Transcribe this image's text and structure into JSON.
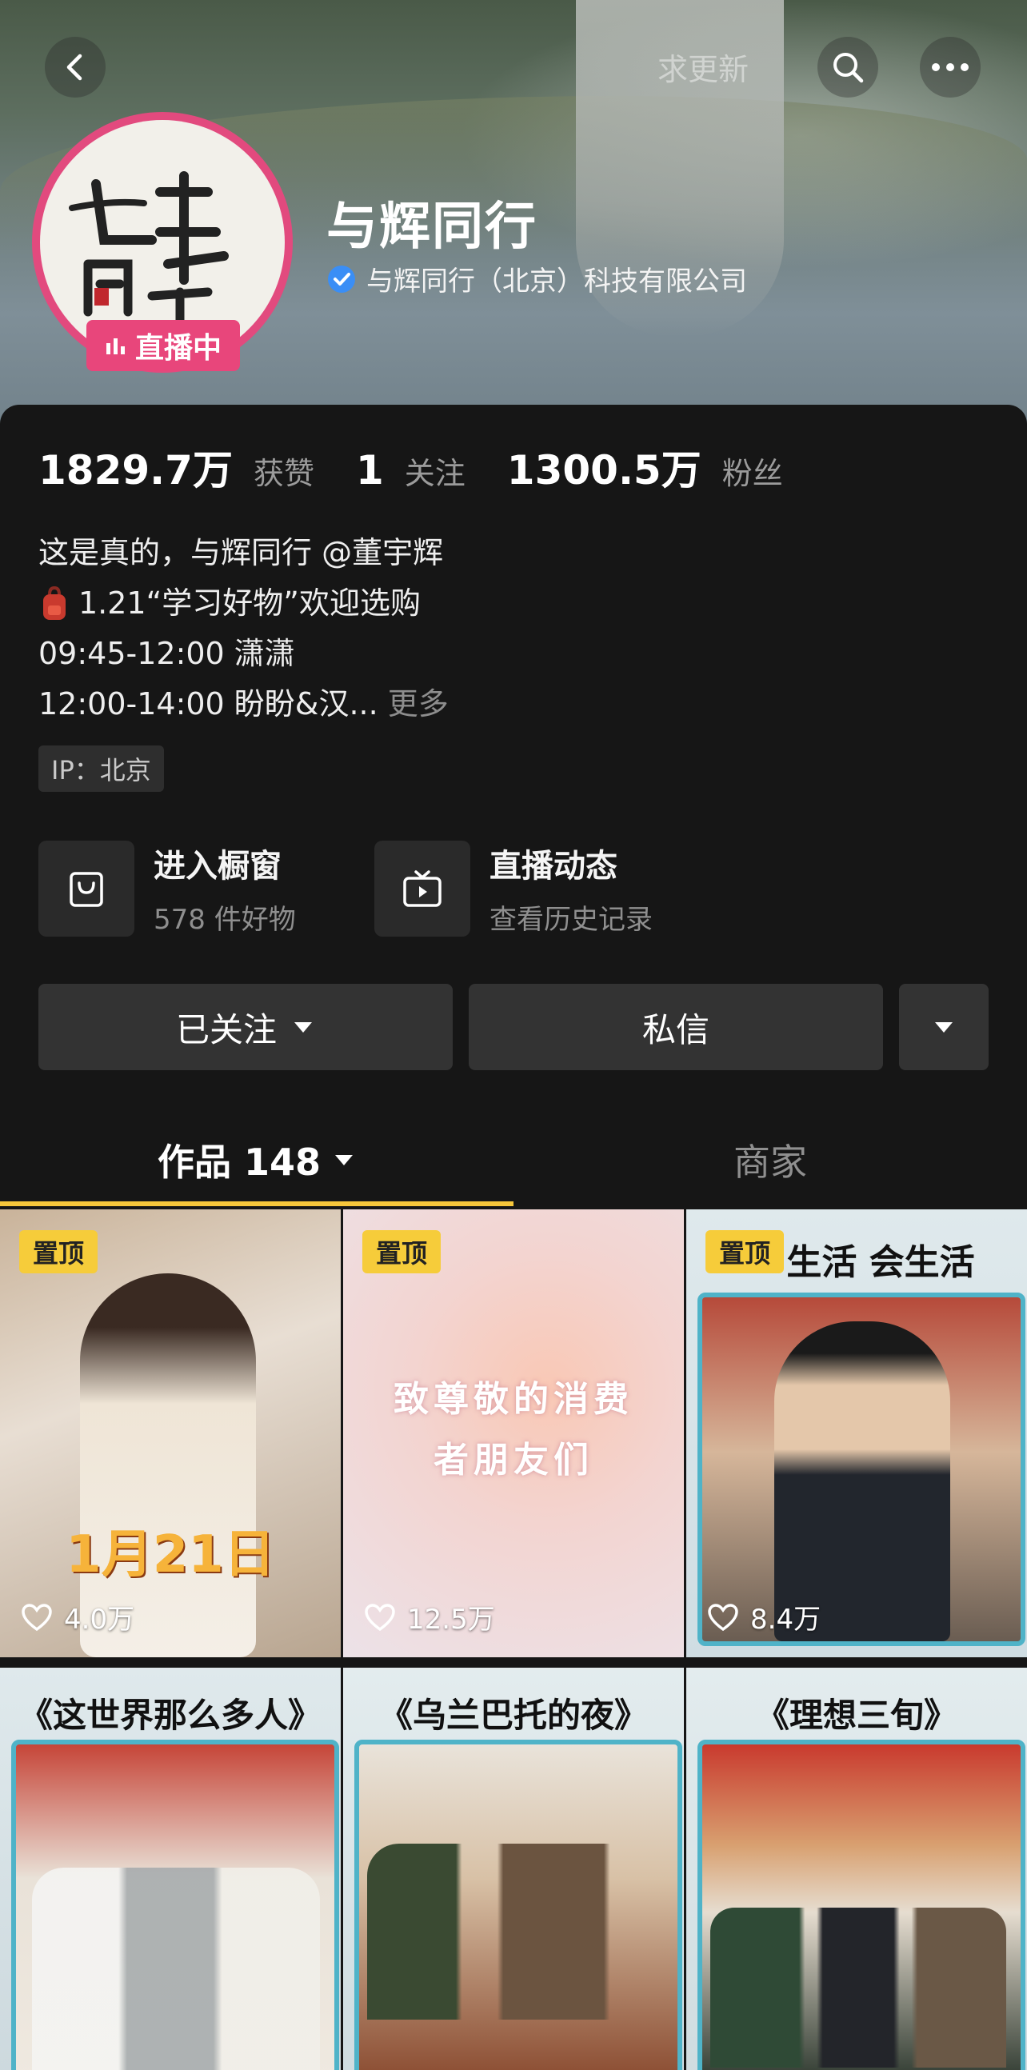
{
  "header": {
    "title_overlay": "求更新",
    "profile_name": "与辉同行",
    "verified_org": "与辉同行（北京）科技有限公司",
    "live_badge": "直播中"
  },
  "stats": [
    {
      "value": "1829.7万",
      "label": "获赞"
    },
    {
      "value": "1",
      "label": "关注"
    },
    {
      "value": "1300.5万",
      "label": "粉丝"
    }
  ],
  "bio": {
    "line1": "这是真的，与辉同行 @董宇辉",
    "line2": "1.21“学习好物”欢迎选购",
    "line3": "09:45-12:00 潇潇",
    "line4": "12:00-14:00 盼盼&汉...",
    "more": "更多"
  },
  "ip": "IP：北京",
  "entries": [
    {
      "title": "进入橱窗",
      "sub": "578 件好物",
      "icon": "shopping-bag-icon"
    },
    {
      "title": "直播动态",
      "sub": "查看历史记录",
      "icon": "tv-play-icon"
    }
  ],
  "actions": {
    "follow": "已关注",
    "message": "私信"
  },
  "tabs": [
    {
      "label": "作品 148",
      "active": true
    },
    {
      "label": "商家",
      "active": false
    }
  ],
  "videos": [
    {
      "pinned": "置顶",
      "likes": "4.0万",
      "overlay": "1月21日"
    },
    {
      "pinned": "置顶",
      "likes": "12.5万",
      "overlay": "致尊敬的消费者朋友们"
    },
    {
      "pinned": "置顶",
      "likes": "8.4万",
      "overlay": "生活 会生活"
    },
    {
      "overlay": "《这世界那么多人》"
    },
    {
      "overlay": "《乌兰巴托的夜》"
    },
    {
      "overlay": "《理想三旬》"
    }
  ],
  "colors": {
    "accent_yellow": "#f6cc3a",
    "live_pink": "#e8467b",
    "verify_blue": "#3a8ef6",
    "panel_bg": "#161616"
  }
}
